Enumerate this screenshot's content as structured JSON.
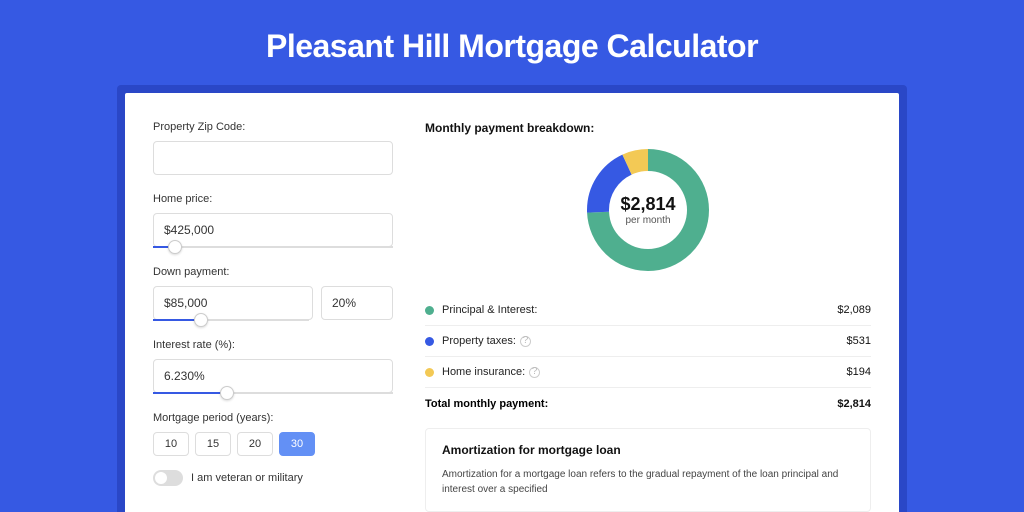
{
  "title": "Pleasant Hill Mortgage Calculator",
  "form": {
    "zip_label": "Property Zip Code:",
    "zip_value": "",
    "home_price_label": "Home price:",
    "home_price_value": "$425,000",
    "home_price_slider_pct": 9,
    "down_payment_label": "Down payment:",
    "down_payment_value": "$85,000",
    "down_payment_pct_value": "20%",
    "down_payment_slider_pct": 20,
    "interest_label": "Interest rate (%):",
    "interest_value": "6.230%",
    "interest_slider_pct": 31,
    "period_label": "Mortgage period (years):",
    "periods": [
      "10",
      "15",
      "20",
      "30"
    ],
    "period_active_index": 3,
    "veteran_label": "I am veteran or military"
  },
  "breakdown": {
    "title": "Monthly payment breakdown:",
    "center_amount": "$2,814",
    "center_sub": "per month",
    "items": [
      {
        "label": "Principal & Interest:",
        "value": "$2,089",
        "color": "green",
        "info": false
      },
      {
        "label": "Property taxes:",
        "value": "$531",
        "color": "blue",
        "info": true
      },
      {
        "label": "Home insurance:",
        "value": "$194",
        "color": "yellow",
        "info": true
      }
    ],
    "total_label": "Total monthly payment:",
    "total_value": "$2,814"
  },
  "chart_data": {
    "type": "pie",
    "title": "Monthly payment breakdown",
    "series": [
      {
        "name": "Principal & Interest",
        "value": 2089
      },
      {
        "name": "Property taxes",
        "value": 531
      },
      {
        "name": "Home insurance",
        "value": 194
      }
    ],
    "total": 2814,
    "colors": {
      "Principal & Interest": "#4faf8f",
      "Property taxes": "#3659e3",
      "Home insurance": "#f3c955"
    }
  },
  "amortization": {
    "title": "Amortization for mortgage loan",
    "text": "Amortization for a mortgage loan refers to the gradual repayment of the loan principal and interest over a specified"
  }
}
